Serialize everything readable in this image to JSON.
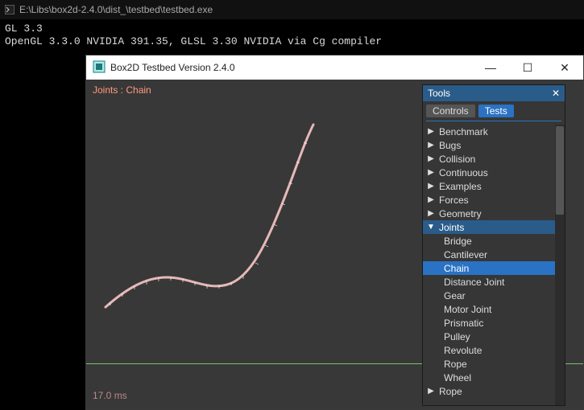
{
  "console": {
    "path": "E:\\Libs\\box2d-2.4.0\\dist_\\testbed\\testbed.exe",
    "line1": "GL 3.3",
    "line2": "OpenGL 3.3.0 NVIDIA 391.35, GLSL 3.30 NVIDIA via Cg compiler"
  },
  "window": {
    "title": "Box2D Testbed Version 2.4.0",
    "minimize_glyph": "—",
    "maximize_glyph": "☐",
    "close_glyph": "✕"
  },
  "scene": {
    "label": "Joints : Chain",
    "frametime": "17.0 ms"
  },
  "tools": {
    "title": "Tools",
    "close_glyph": "✕",
    "tabs": {
      "controls": "Controls",
      "tests": "Tests",
      "active": "Tests"
    },
    "categories": [
      {
        "name": "Benchmark",
        "expanded": false
      },
      {
        "name": "Bugs",
        "expanded": false
      },
      {
        "name": "Collision",
        "expanded": false
      },
      {
        "name": "Continuous",
        "expanded": false
      },
      {
        "name": "Examples",
        "expanded": false
      },
      {
        "name": "Forces",
        "expanded": false
      },
      {
        "name": "Geometry",
        "expanded": false
      },
      {
        "name": "Joints",
        "expanded": true,
        "selected": true,
        "items": [
          "Bridge",
          "Cantilever",
          "Chain",
          "Distance Joint",
          "Gear",
          "Motor Joint",
          "Prismatic",
          "Pulley",
          "Revolute",
          "Rope",
          "Wheel"
        ],
        "selected_item": "Chain"
      },
      {
        "name": "Rope",
        "expanded": false
      }
    ]
  },
  "colors": {
    "titlebar_accent": "#2a5c8a",
    "highlight": "#2a72c4",
    "scene_bg": "#383838",
    "chain": "#e6b8b8",
    "ground": "#79c36b"
  }
}
